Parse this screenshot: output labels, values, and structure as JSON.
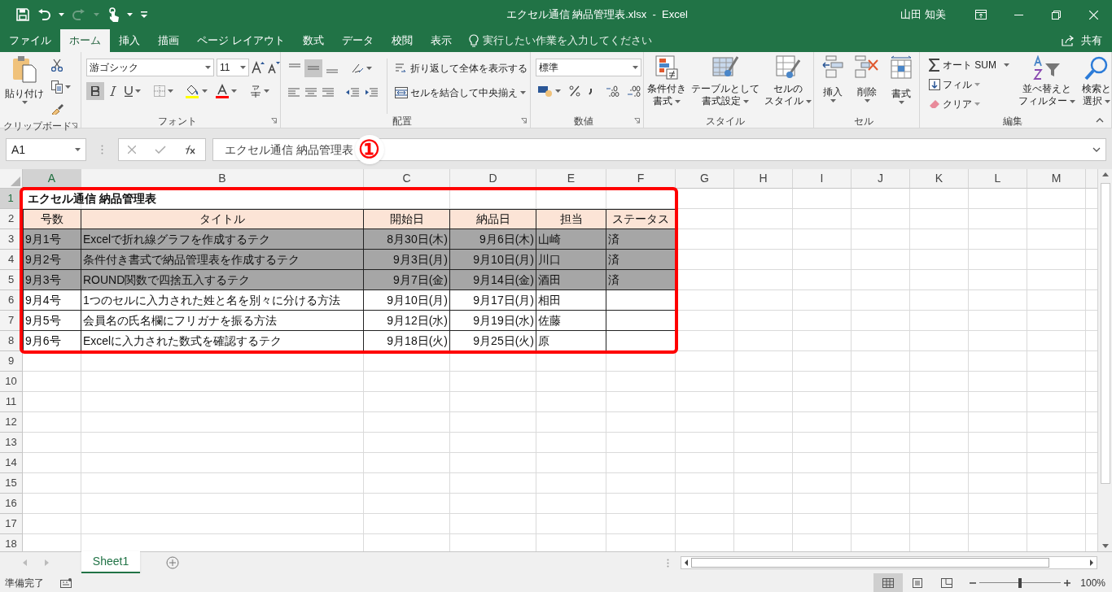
{
  "window": {
    "title": "エクセル通信 納品管理表.xlsx  -  Excel",
    "user": "山田 知美"
  },
  "ribbon_tabs": [
    {
      "label": "ファイル",
      "selected": false
    },
    {
      "label": "ホーム",
      "selected": true
    },
    {
      "label": "挿入",
      "selected": false
    },
    {
      "label": "描画",
      "selected": false
    },
    {
      "label": "ページ レイアウト",
      "selected": false
    },
    {
      "label": "数式",
      "selected": false
    },
    {
      "label": "データ",
      "selected": false
    },
    {
      "label": "校閲",
      "selected": false
    },
    {
      "label": "表示",
      "selected": false
    }
  ],
  "tell_me": {
    "placeholder": "実行したい作業を入力してください"
  },
  "share": "共有",
  "ribbon": {
    "clipboard": {
      "paste": "貼り付け",
      "label": "クリップボード"
    },
    "font": {
      "font_name": "游ゴシック",
      "font_size": "11",
      "bold": true,
      "label": "フォント"
    },
    "alignment": {
      "vertical": [
        {
          "selected": false
        },
        {
          "selected": true
        },
        {
          "selected": false
        }
      ],
      "wrap": "折り返して全体を表示する",
      "merge": "セルを結合して中央揃え",
      "label": "配置"
    },
    "number": {
      "format": "標準",
      "label": "数値"
    },
    "styles": {
      "buttons": [
        {
          "lines": [
            "条件付き",
            "書式"
          ]
        },
        {
          "lines": [
            "テーブルとして",
            "書式設定"
          ]
        },
        {
          "lines": [
            "セルの",
            "スタイル"
          ]
        }
      ],
      "label": "スタイル"
    },
    "cells": {
      "buttons": [
        "挿入",
        "削除",
        "書式"
      ],
      "label": "セル"
    },
    "editing": {
      "autosum": "オート SUM",
      "fill": "フィル",
      "clear": "クリア",
      "sort": [
        "並べ替えと",
        "フィルター"
      ],
      "find": [
        "検索と",
        "選択"
      ],
      "label": "編集"
    }
  },
  "formula_bar": {
    "name_box": "A1",
    "content": "エクセル通信 納品管理表"
  },
  "annotation": {
    "marker": "①"
  },
  "columns": [
    {
      "label": "A",
      "selected": true
    },
    {
      "label": "B",
      "selected": false
    },
    {
      "label": "C",
      "selected": false
    },
    {
      "label": "D",
      "selected": false
    },
    {
      "label": "E",
      "selected": false
    },
    {
      "label": "F",
      "selected": false
    },
    {
      "label": "G",
      "selected": false
    },
    {
      "label": "H",
      "selected": false
    },
    {
      "label": "I",
      "selected": false
    },
    {
      "label": "J",
      "selected": false
    },
    {
      "label": "K",
      "selected": false
    },
    {
      "label": "L",
      "selected": false
    },
    {
      "label": "M",
      "selected": false
    }
  ],
  "rows": [
    {
      "number": "1",
      "selected": true,
      "kind": "title",
      "cells": [
        "エクセル通信 納品管理表"
      ]
    },
    {
      "number": "2",
      "selected": false,
      "kind": "header",
      "cells": [
        "号数",
        "タイトル",
        "開始日",
        "納品日",
        "担当",
        "ステータス"
      ]
    },
    {
      "number": "3",
      "selected": false,
      "kind": "data",
      "shaded": true,
      "cells": [
        "9月1号",
        "Excelで折れ線グラフを作成するテク",
        "8月30日(木)",
        "9月6日(木)",
        "山崎",
        "済"
      ]
    },
    {
      "number": "4",
      "selected": false,
      "kind": "data",
      "shaded": true,
      "cells": [
        "9月2号",
        "条件付き書式で納品管理表を作成するテク",
        "9月3日(月)",
        "9月10日(月)",
        "川口",
        "済"
      ]
    },
    {
      "number": "5",
      "selected": false,
      "kind": "data",
      "shaded": true,
      "cells": [
        "9月3号",
        "ROUND関数で四捨五入するテク",
        "9月7日(金)",
        "9月14日(金)",
        "酒田",
        "済"
      ]
    },
    {
      "number": "6",
      "selected": false,
      "kind": "data",
      "shaded": false,
      "cells": [
        "9月4号",
        "1つのセルに入力された姓と名を別々に分ける方法",
        "9月10日(月)",
        "9月17日(月)",
        "相田"
      ]
    },
    {
      "number": "7",
      "selected": false,
      "kind": "data",
      "shaded": false,
      "cells": [
        "9月5号",
        "会員名の氏名欄にフリガナを振る方法",
        "9月12日(水)",
        "9月19日(水)",
        "佐藤"
      ]
    },
    {
      "number": "8",
      "selected": false,
      "kind": "data",
      "shaded": false,
      "cells": [
        "9月6号",
        "Excelに入力された数式を確認するテク",
        "9月18日(火)",
        "9月25日(火)",
        "原"
      ]
    },
    {
      "number": "9",
      "selected": false,
      "kind": "empty"
    },
    {
      "number": "10",
      "selected": false,
      "kind": "empty"
    },
    {
      "number": "11",
      "selected": false,
      "kind": "empty"
    },
    {
      "number": "12",
      "selected": false,
      "kind": "empty"
    },
    {
      "number": "13",
      "selected": false,
      "kind": "empty"
    },
    {
      "number": "14",
      "selected": false,
      "kind": "empty"
    },
    {
      "number": "15",
      "selected": false,
      "kind": "empty"
    },
    {
      "number": "16",
      "selected": false,
      "kind": "empty"
    },
    {
      "number": "17",
      "selected": false,
      "kind": "empty"
    },
    {
      "number": "18",
      "selected": false,
      "kind": "empty"
    }
  ],
  "sheet_tabs": [
    {
      "label": "Sheet1",
      "selected": true
    }
  ],
  "status_bar": {
    "status": "準備完了",
    "views": [
      {
        "selected": true
      },
      {
        "selected": false
      },
      {
        "selected": false
      }
    ],
    "zoom": {
      "level": 0.5
    },
    "zoom_reading": "100%"
  }
}
